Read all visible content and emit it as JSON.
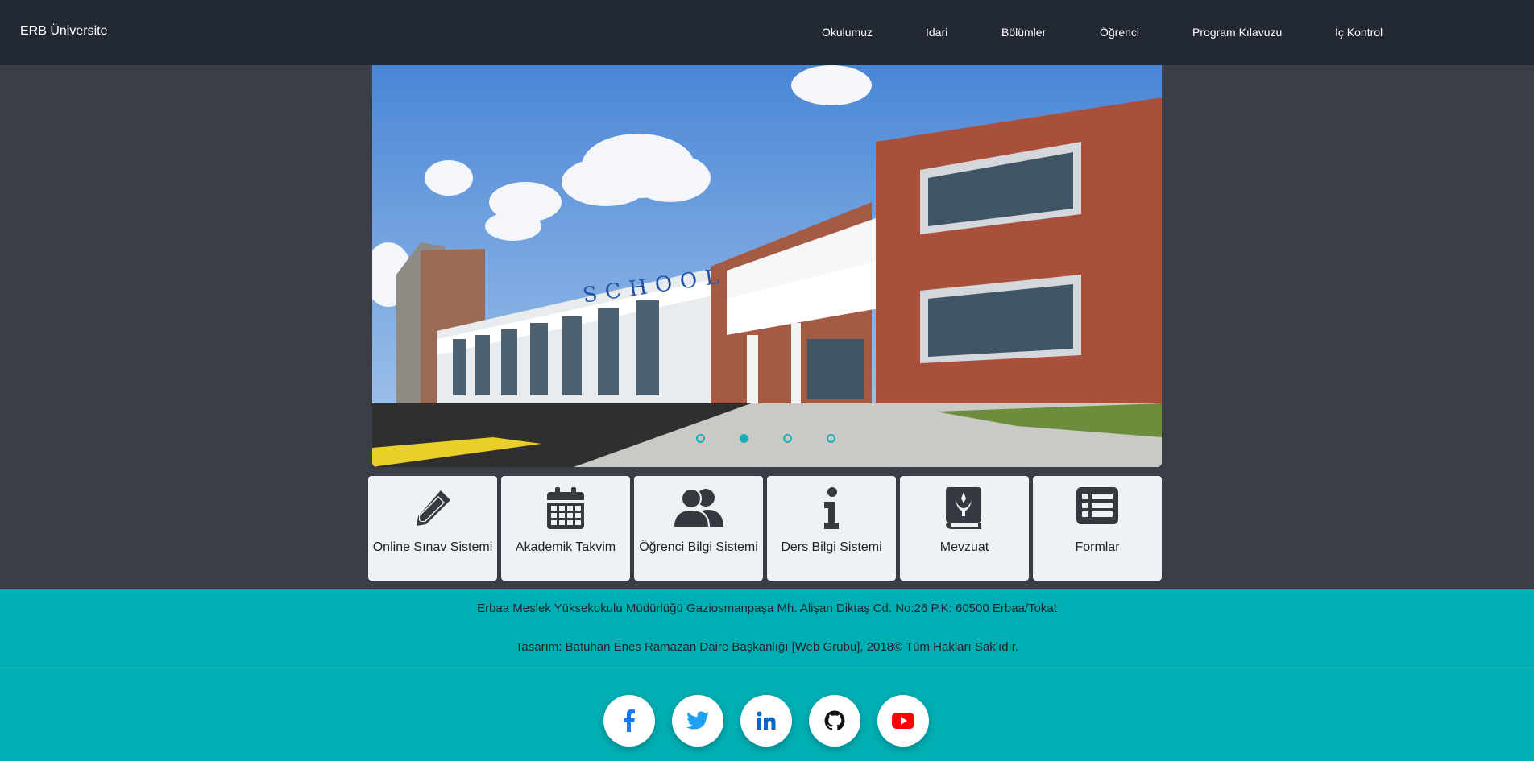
{
  "navbar": {
    "brand": "ERB Üniversite",
    "links": [
      "Okulumuz",
      "İdari",
      "Bölümler",
      "Öğrenci",
      "Program Kılavuzu",
      "İç Kontrol"
    ]
  },
  "slider": {
    "image_text": "SCHOOL",
    "slide_count": 4,
    "active_slide": 2
  },
  "cards": [
    {
      "label": "Online Sınav Sistemi",
      "icon": "pencil-icon"
    },
    {
      "label": "Akademik Takvim",
      "icon": "calendar-icon"
    },
    {
      "label": "Öğrenci Bilgi Sistemi",
      "icon": "users-icon"
    },
    {
      "label": "Ders Bilgi Sistemi",
      "icon": "info-icon"
    },
    {
      "label": "Mevzuat",
      "icon": "book-icon"
    },
    {
      "label": "Formlar",
      "icon": "list-icon"
    }
  ],
  "footer": {
    "address": "Erbaa Meslek Yüksekokulu Müdürlüğü Gaziosmanpaşa Mh. Alişan Diktaş Cd. No:26 P.K: 60500 Erbaa/Tokat",
    "credits": "Tasarım: Batuhan Enes Ramazan Daire Başkanlığı [Web Grubu], 2018© Tüm Hakları Saklıdır.",
    "social": [
      "facebook-icon",
      "twitter-icon",
      "linkedin-icon",
      "github-icon",
      "youtube-icon"
    ]
  },
  "colors": {
    "navbar": "#232932",
    "body": "#3a3f47",
    "accent": "#00aeb3",
    "card": "#eef2f5",
    "facebook": "#1877f2",
    "twitter": "#1da1f2",
    "linkedin": "#0a66c2",
    "github": "#111111",
    "youtube": "#ff0000"
  }
}
